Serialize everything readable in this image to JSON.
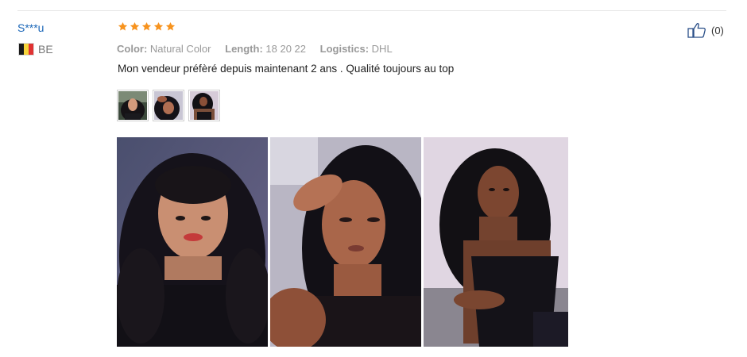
{
  "review": {
    "reviewer_name": "S***u",
    "country_code": "BE",
    "flag_colors": [
      "#1a1a1a",
      "#f6d53a",
      "#e03232"
    ],
    "rating": 5,
    "star_color": "#f7931e",
    "attributes": [
      {
        "label": "Color:",
        "value": "Natural Color"
      },
      {
        "label": "Length:",
        "value": "18 20 22"
      },
      {
        "label": "Logistics:",
        "value": "DHL"
      }
    ],
    "text": "Mon vendeur préfèré depuis maintenant 2 ans . Qualité toujours au top",
    "helpful_count": "(0)",
    "thumbnail_count": 3,
    "photo_count": 3
  },
  "icons": {
    "star": "star-icon",
    "helpful": "thumbs-up-icon",
    "flag": "belgium-flag-icon"
  }
}
